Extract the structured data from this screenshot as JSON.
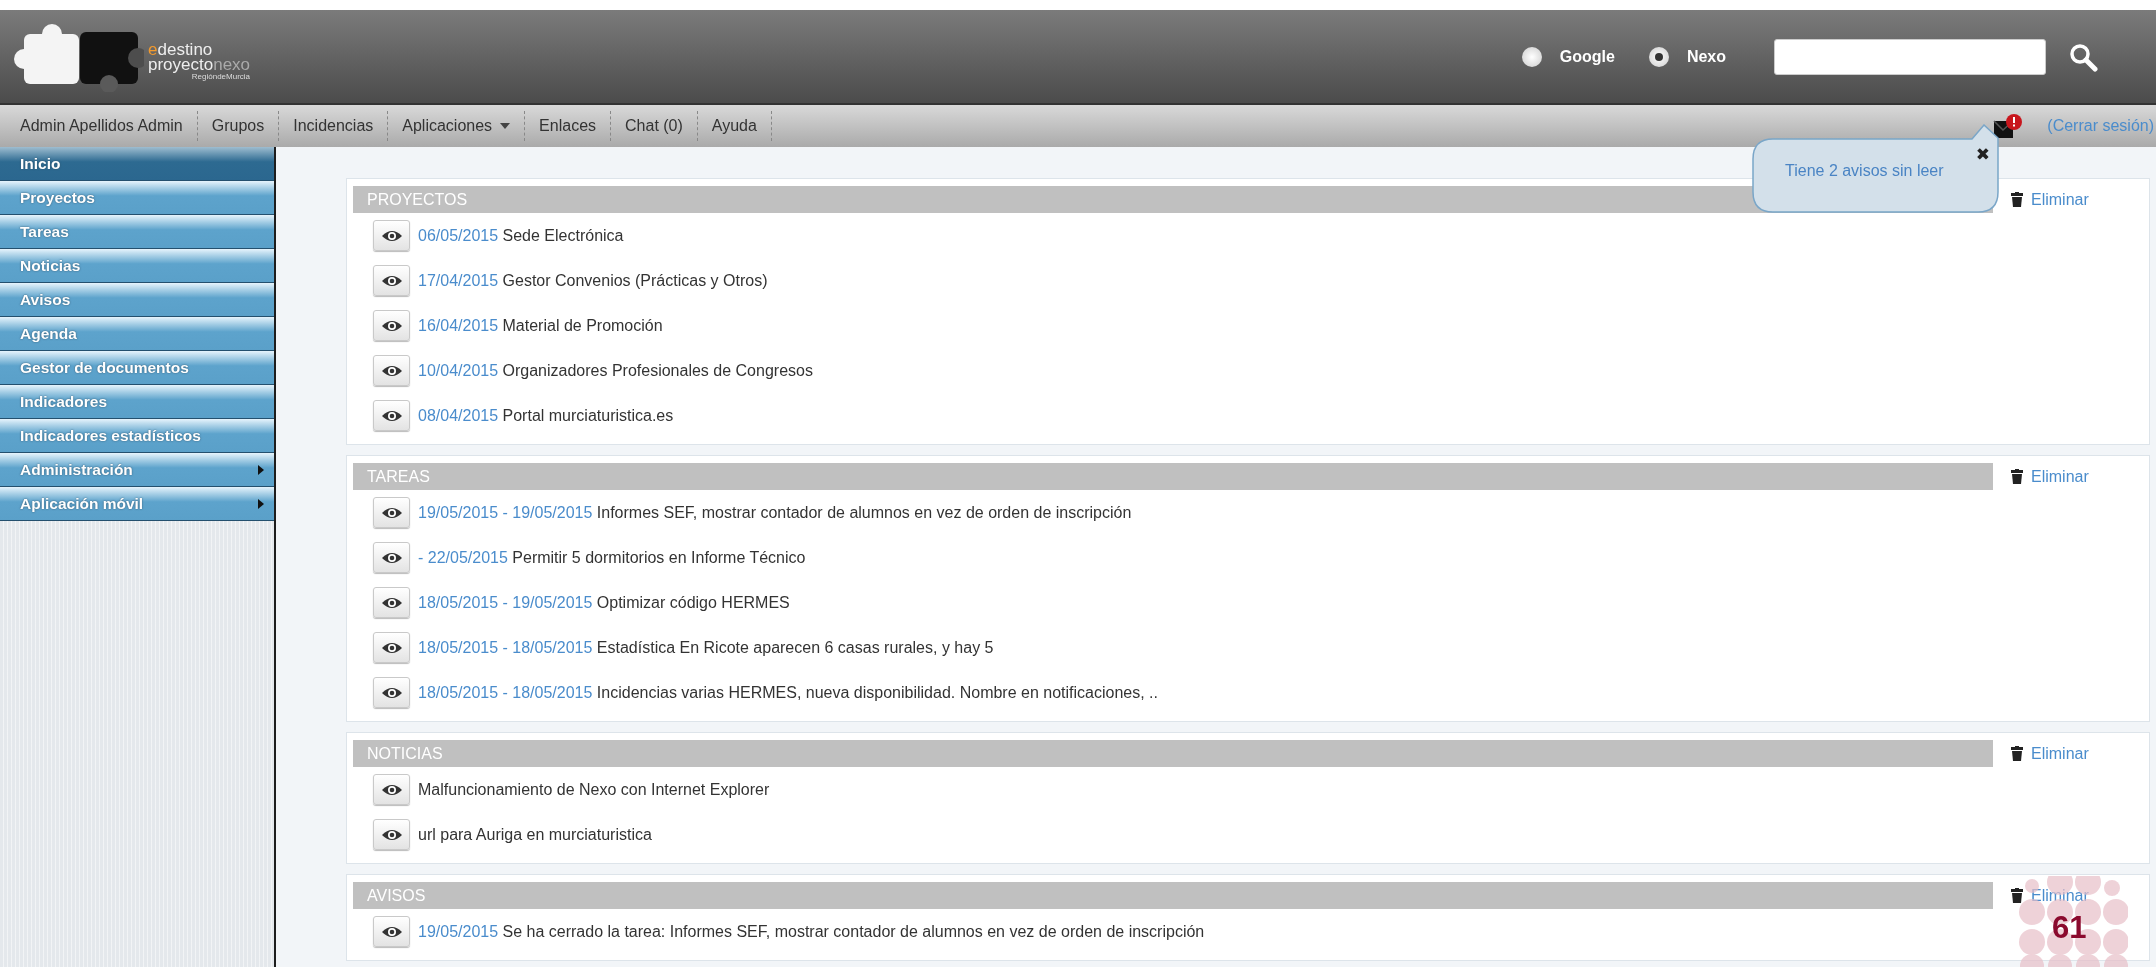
{
  "header": {
    "logo": {
      "accent_prefix": "e",
      "line_1": "destino",
      "line_2": "proyecto",
      "line_2_accent": "nexo",
      "line_3": "RegióndeMurcia"
    },
    "search_scope": [
      {
        "label": "Google",
        "selected": false
      },
      {
        "label": "Nexo",
        "selected": true
      }
    ]
  },
  "nav": {
    "items": [
      {
        "label": "Admin Apellidos Admin",
        "dropdown": false
      },
      {
        "label": "Grupos",
        "dropdown": false
      },
      {
        "label": "Incidencias",
        "dropdown": false
      },
      {
        "label": "Aplicaciones",
        "dropdown": true
      },
      {
        "label": "Enlaces",
        "dropdown": false
      },
      {
        "label": "Chat (0)",
        "dropdown": false
      },
      {
        "label": "Ayuda",
        "dropdown": false
      }
    ],
    "notifications": {
      "unread": true
    },
    "logout": "(Cerrar sesión)"
  },
  "popover": {
    "message": "Tiene 2 avisos sin leer",
    "close": "✖"
  },
  "sidebar": {
    "items": [
      {
        "label": "Inicio",
        "selected": true,
        "submenu": false
      },
      {
        "label": "Proyectos",
        "selected": false,
        "submenu": false
      },
      {
        "label": "Tareas",
        "selected": false,
        "submenu": false
      },
      {
        "label": "Noticias",
        "selected": false,
        "submenu": false
      },
      {
        "label": "Avisos",
        "selected": false,
        "submenu": false
      },
      {
        "label": "Agenda",
        "selected": false,
        "submenu": false
      },
      {
        "label": "Gestor de documentos",
        "selected": false,
        "submenu": false
      },
      {
        "label": "Indicadores",
        "selected": false,
        "submenu": false
      },
      {
        "label": "Indicadores estadísticos",
        "selected": false,
        "submenu": false
      },
      {
        "label": "Administración",
        "selected": false,
        "submenu": true
      },
      {
        "label": "Aplicación móvil",
        "selected": false,
        "submenu": true
      }
    ]
  },
  "panels": [
    {
      "title": "PROYECTOS",
      "action": "Eliminar",
      "items": [
        {
          "date": "06/05/2015",
          "text": "Sede Electrónica"
        },
        {
          "date": "17/04/2015",
          "text": "Gestor Convenios (Prácticas y Otros)"
        },
        {
          "date": "16/04/2015",
          "text": "Material de Promoción"
        },
        {
          "date": "10/04/2015",
          "text": "Organizadores Profesionales de Congresos"
        },
        {
          "date": "08/04/2015",
          "text": "Portal murciaturistica.es"
        }
      ]
    },
    {
      "title": "TAREAS",
      "action": "Eliminar",
      "items": [
        {
          "date": "19/05/2015 - 19/05/2015",
          "text": "Informes SEF, mostrar contador de alumnos en vez de orden de inscripción"
        },
        {
          "date": "- 22/05/2015",
          "text": "Permitir 5 dormitorios en Informe Técnico"
        },
        {
          "date": "18/05/2015 - 19/05/2015",
          "text": "Optimizar código HERMES"
        },
        {
          "date": "18/05/2015 - 18/05/2015",
          "text": "Estadística En Ricote aparecen 6 casas rurales, y hay 5"
        },
        {
          "date": "18/05/2015 - 18/05/2015",
          "text": "Incidencias varias HERMES, nueva disponibilidad. Nombre en notificaciones, .."
        }
      ]
    },
    {
      "title": "NOTICIAS",
      "action": "Eliminar",
      "items": [
        {
          "text": "Malfuncionamiento de Nexo con Internet Explorer"
        },
        {
          "text": "url para Auriga en murciaturistica"
        }
      ]
    },
    {
      "title": "AVISOS",
      "action": "Eliminar",
      "items": [
        {
          "date": "19/05/2015",
          "text": "Se ha cerrado la tarea: Informes SEF, mostrar contador de alumnos en vez de orden de inscripción"
        }
      ]
    }
  ],
  "slide_number": "61"
}
